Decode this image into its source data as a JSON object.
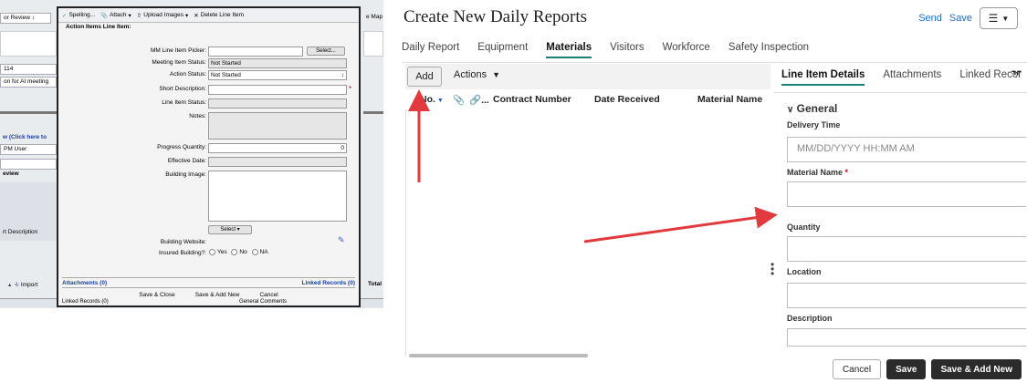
{
  "old_ui": {
    "bg": {
      "status_select": "or Review ↕",
      "map_label": "e Map",
      "row_114": "114",
      "row_meeting": "on for AI meeting",
      "click_here": "w (Click here to",
      "pm_user": "PM User",
      "review": "eview",
      "short_desc": "rt Description",
      "import": "Import",
      "total": "Total",
      "linked_bottom": "Linked Records (0)",
      "general_comments": "General Comments"
    },
    "toolbar": {
      "spelling": "Spelling...",
      "attach": "Attach",
      "upload": "Upload Images",
      "delete": "Delete Line Item"
    },
    "section_title": "Action Items Line Item:",
    "fields": {
      "mm_picker_label": "MM Line Item Picker:",
      "select_btn": "Select...",
      "meeting_status_label": "Meeting Item Status:",
      "meeting_status_value": "Not Started",
      "action_status_label": "Action Status:",
      "action_status_value": "Not Started",
      "short_desc_label": "Short Description:",
      "line_status_label": "Line Item Status:",
      "notes_label": "Notes:",
      "progress_label": "Progress Quantity:",
      "progress_value": "0",
      "effective_label": "Effective Date:",
      "building_image_label": "Building Image:",
      "select_dropdown": "Select ▾",
      "website_label": "Building Website:",
      "insured_label": "Insured Building?:",
      "yes": "Yes",
      "no": "No",
      "na": "NA"
    },
    "attachments": "Attachments (0)",
    "linked_records": "Linked Records (0)",
    "buttons": {
      "save_close": "Save & Close",
      "save_add": "Save & Add New",
      "cancel": "Cancel"
    }
  },
  "new_ui": {
    "title": "Create New Daily Reports",
    "send": "Send",
    "save": "Save",
    "tabs": [
      "Daily Report",
      "Equipment",
      "Materials",
      "Visitors",
      "Workforce",
      "Safety Inspection"
    ],
    "active_tab": "Materials",
    "list": {
      "add": "Add",
      "actions": "Actions",
      "col_no": "No.",
      "col_dots": "...",
      "col_contract": "Contract Number",
      "col_date": "Date Received",
      "col_material": "Material Name"
    },
    "detail": {
      "tabs": [
        "Line Item Details",
        "Attachments",
        "Linked Recor"
      ],
      "section": "General",
      "delivery_label": "Delivery Time",
      "delivery_placeholder": "MM/DD/YYYY HH:MM AM",
      "material_label": "Material Name",
      "required_star": "*",
      "quantity_label": "Quantity",
      "location_label": "Location",
      "description_label": "Description"
    },
    "footer": {
      "cancel": "Cancel",
      "save": "Save",
      "save_add": "Save & Add New"
    }
  },
  "colors": {
    "accent_teal": "#1a7f74",
    "link_blue": "#1f6fbf",
    "arrow_red": "#e0393e",
    "dark_button": "#2b2b2b"
  }
}
